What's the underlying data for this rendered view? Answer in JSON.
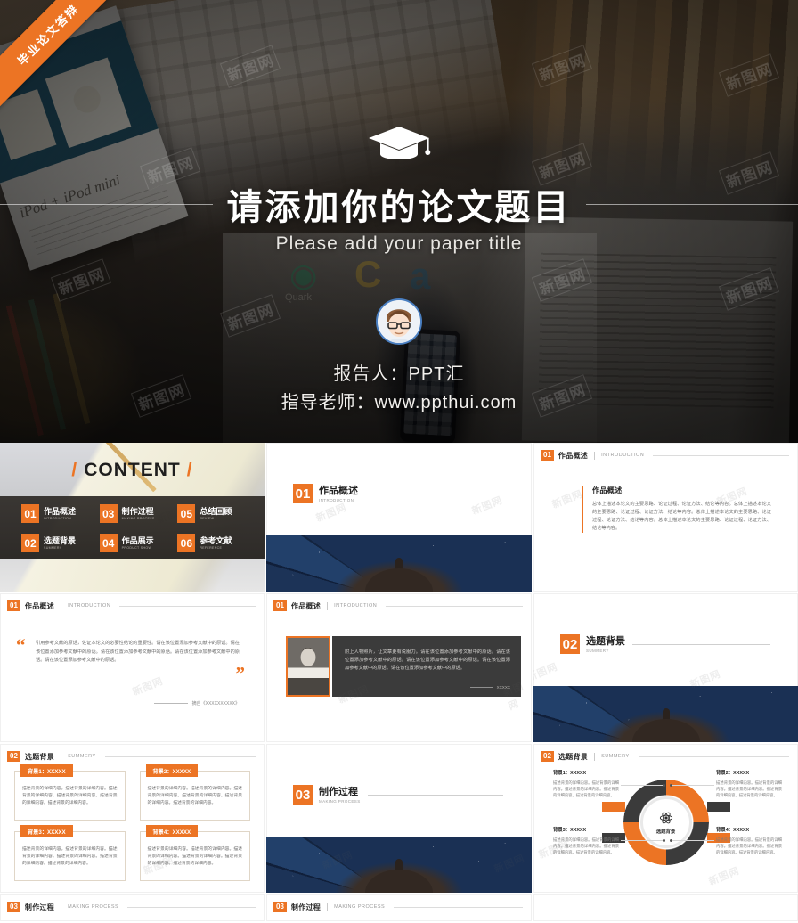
{
  "ribbon": {
    "label": "毕业论文答辩"
  },
  "hero": {
    "icon": "graduation-cap-icon",
    "title": "请添加你的论文题目",
    "subtitle": "Please add your paper title",
    "presenter": "报告人：PPT汇",
    "advisor": "指导老师：www.ppthui.com",
    "watermark": "新图网"
  },
  "content_slide": {
    "title": "CONTENT",
    "slash": "/",
    "items": [
      {
        "num": "01",
        "cn": "作品概述",
        "en": "INTRODUCTION"
      },
      {
        "num": "03",
        "cn": "制作过程",
        "en": "MAKING PROCESS"
      },
      {
        "num": "05",
        "cn": "总结回顾",
        "en": "REVIEW"
      },
      {
        "num": "02",
        "cn": "选题背景",
        "en": "SUMMERY"
      },
      {
        "num": "04",
        "cn": "作品展示",
        "en": "PRODUCT SHOW"
      },
      {
        "num": "06",
        "cn": "参考文献",
        "en": "REFERENCE"
      }
    ]
  },
  "divider_01": {
    "num": "01",
    "cn": "作品概述",
    "en": "INTRODUCTION"
  },
  "divider_02": {
    "num": "02",
    "cn": "选题背景",
    "en": "SUMMERY"
  },
  "divider_03": {
    "num": "03",
    "cn": "制作过程",
    "en": "MAKING PROCESS"
  },
  "header_01": {
    "num": "01",
    "cn": "作品概述",
    "en": "INTRODUCTION"
  },
  "header_02": {
    "num": "02",
    "cn": "选题背景",
    "en": "SUMMERY"
  },
  "header_03": {
    "num": "03",
    "cn": "制作过程",
    "en": "MAKING PROCESS"
  },
  "overview_slide": {
    "heading": "作品概述",
    "body": "总体上描述本论文的主要思路、论证过程、论证方法、结论等内容。总体上描述本论文的主要思路、论证过程、论证方法、结论等内容。总体上描述本论文的主要思路、论证过程、论证方法、结论等内容。总体上描述本论文的主要思路、论证过程、论证方法、结论等内容。"
  },
  "quote_slide": {
    "quote_open": "“",
    "quote_close": "”",
    "body": "引用参考文献的原话，佐证本论文的必要性结论的重要性。请在该位置添加参考文献中的原话。请在该位置添加参考文献中的原话。请在该位置添加参考文献中的原话。请在该位置添加参考文献中的原话。请在该位置添加参考文献中的原话。",
    "attribution": "摘自《XXXXXXXXXX》"
  },
  "portrait_slide": {
    "image_alt": "speaker-portrait",
    "body": "附上人物照片，让文章更有说服力。请在该位置添加参考文献中的原话。请在该位置添加参考文献中的原话。请在该位置添加参考文献中的原话。请在该位置添加参考文献中的原话。请在该位置添加参考文献中的原话。",
    "attribution": "XXXXX"
  },
  "boxes_slide": {
    "items": [
      {
        "title": "背景1：XXXXX",
        "body": "描述背景的详细内容。描述背景的详细内容。描述背景的详细内容。描述背景的详细内容。描述背景的详细内容。描述背景的详细内容。"
      },
      {
        "title": "背景2：XXXXX",
        "body": "描述背景的详细内容。描述背景的详细内容。描述背景的详细内容。描述背景的详细内容。描述背景的详细内容。描述背景的详细内容。"
      },
      {
        "title": "背景3：XXXXX",
        "body": "描述背景的详细内容。描述背景的详细内容。描述背景的详细内容。描述背景的详细内容。描述背景的详细内容。描述背景的详细内容。"
      },
      {
        "title": "背景4：XXXXX",
        "body": "描述背景的详细内容。描述背景的详细内容。描述背景的详细内容。描述背景的详细内容。描述背景的详细内容。描述背景的详细内容。"
      }
    ]
  },
  "circle_slide": {
    "center_label": "选题背景",
    "center_icon": "atom-icon",
    "items": [
      {
        "title": "背景1：XXXXX",
        "body": "描述背景的详细内容。描述背景的详细内容。描述背景的详细内容。描述背景的详细内容。描述背景的详细内容。"
      },
      {
        "title": "背景2：XXXXX",
        "body": "描述背景的详细内容。描述背景的详细内容。描述背景的详细内容。描述背景的详细内容。描述背景的详细内容。"
      },
      {
        "title": "背景3：XXXXX",
        "body": "描述背景的详细内容。描述背景的详细内容。描述背景的详细内容。描述背景的详细内容。描述背景的详细内容。"
      },
      {
        "title": "背景4：XXXXX",
        "body": "描述背景的详细内容。描述背景的详细内容。描述背景的详细内容。描述背景的详细内容。描述背景的详细内容。"
      }
    ]
  },
  "colors": {
    "accent": "#ec7424",
    "dark": "#3b3b3b",
    "text": "#6f6f6f",
    "umbrella_blue": "#1d3354"
  }
}
